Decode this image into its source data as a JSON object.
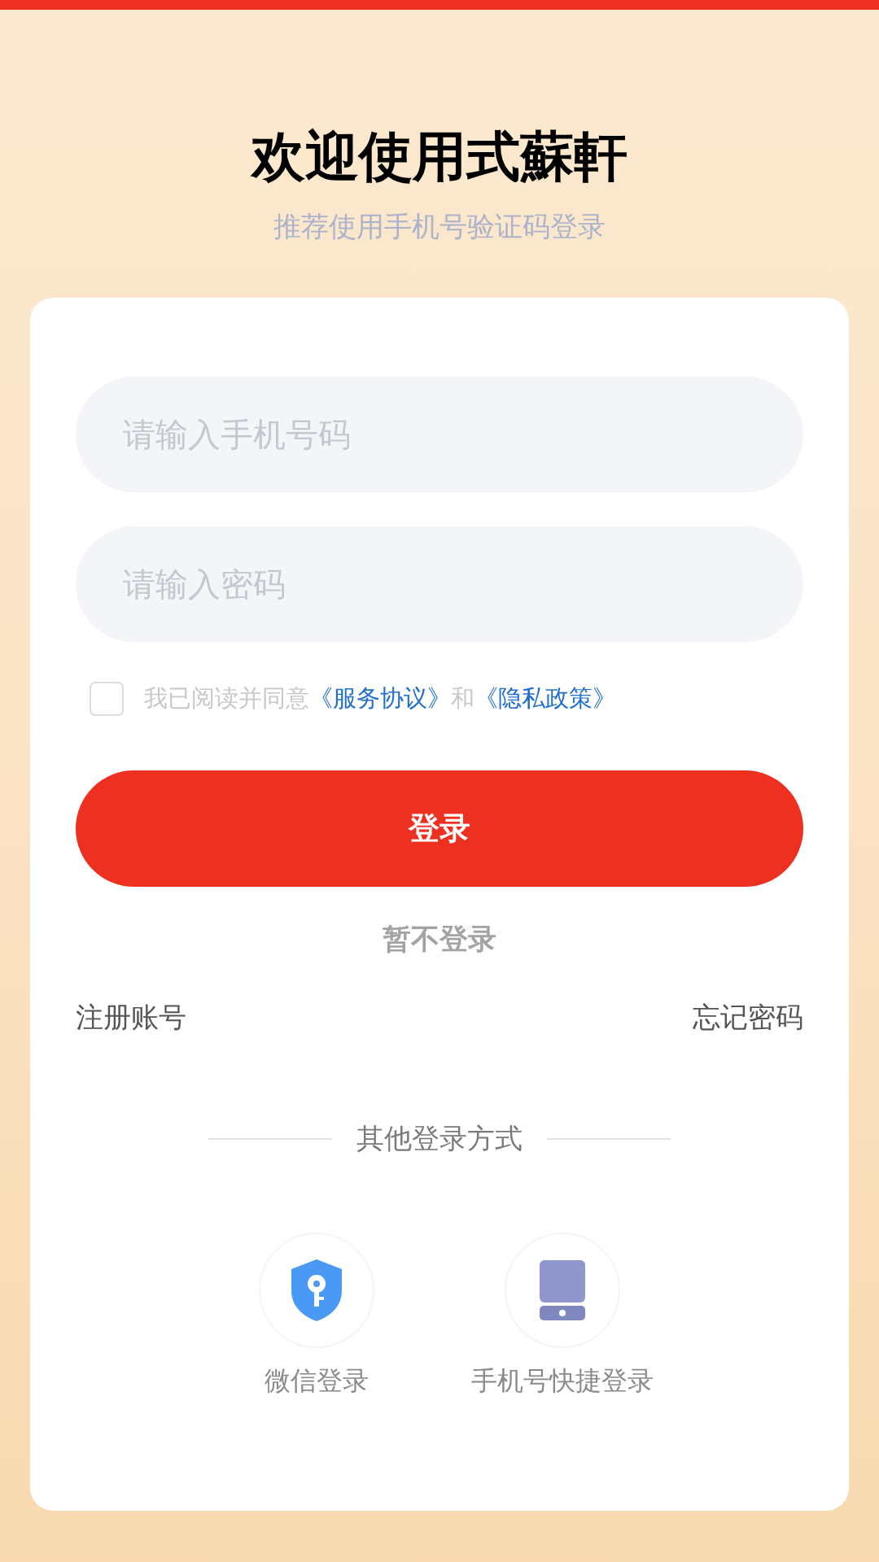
{
  "header": {
    "title": "欢迎使用式蘇軒",
    "subtitle": "推荐使用手机号验证码登录"
  },
  "fields": [
    {
      "placeholder": "请输入手机号码"
    },
    {
      "placeholder": "请输入密码"
    }
  ],
  "agreement": {
    "checked": false,
    "text": "我已阅读并同意",
    "link_1": "《服务协议》",
    "joiner": "和",
    "link_2": "《隐私政策》"
  },
  "login_button": "登录",
  "skip_link": "暂不登录",
  "register_link": "注册账号",
  "forgot_link": "忘记密码",
  "other_methods_label": "其他登录方式",
  "methods": [
    {
      "kind": "shield-key",
      "label": "微信登录"
    },
    {
      "kind": "phone",
      "label": "手机号快捷登录"
    }
  ]
}
